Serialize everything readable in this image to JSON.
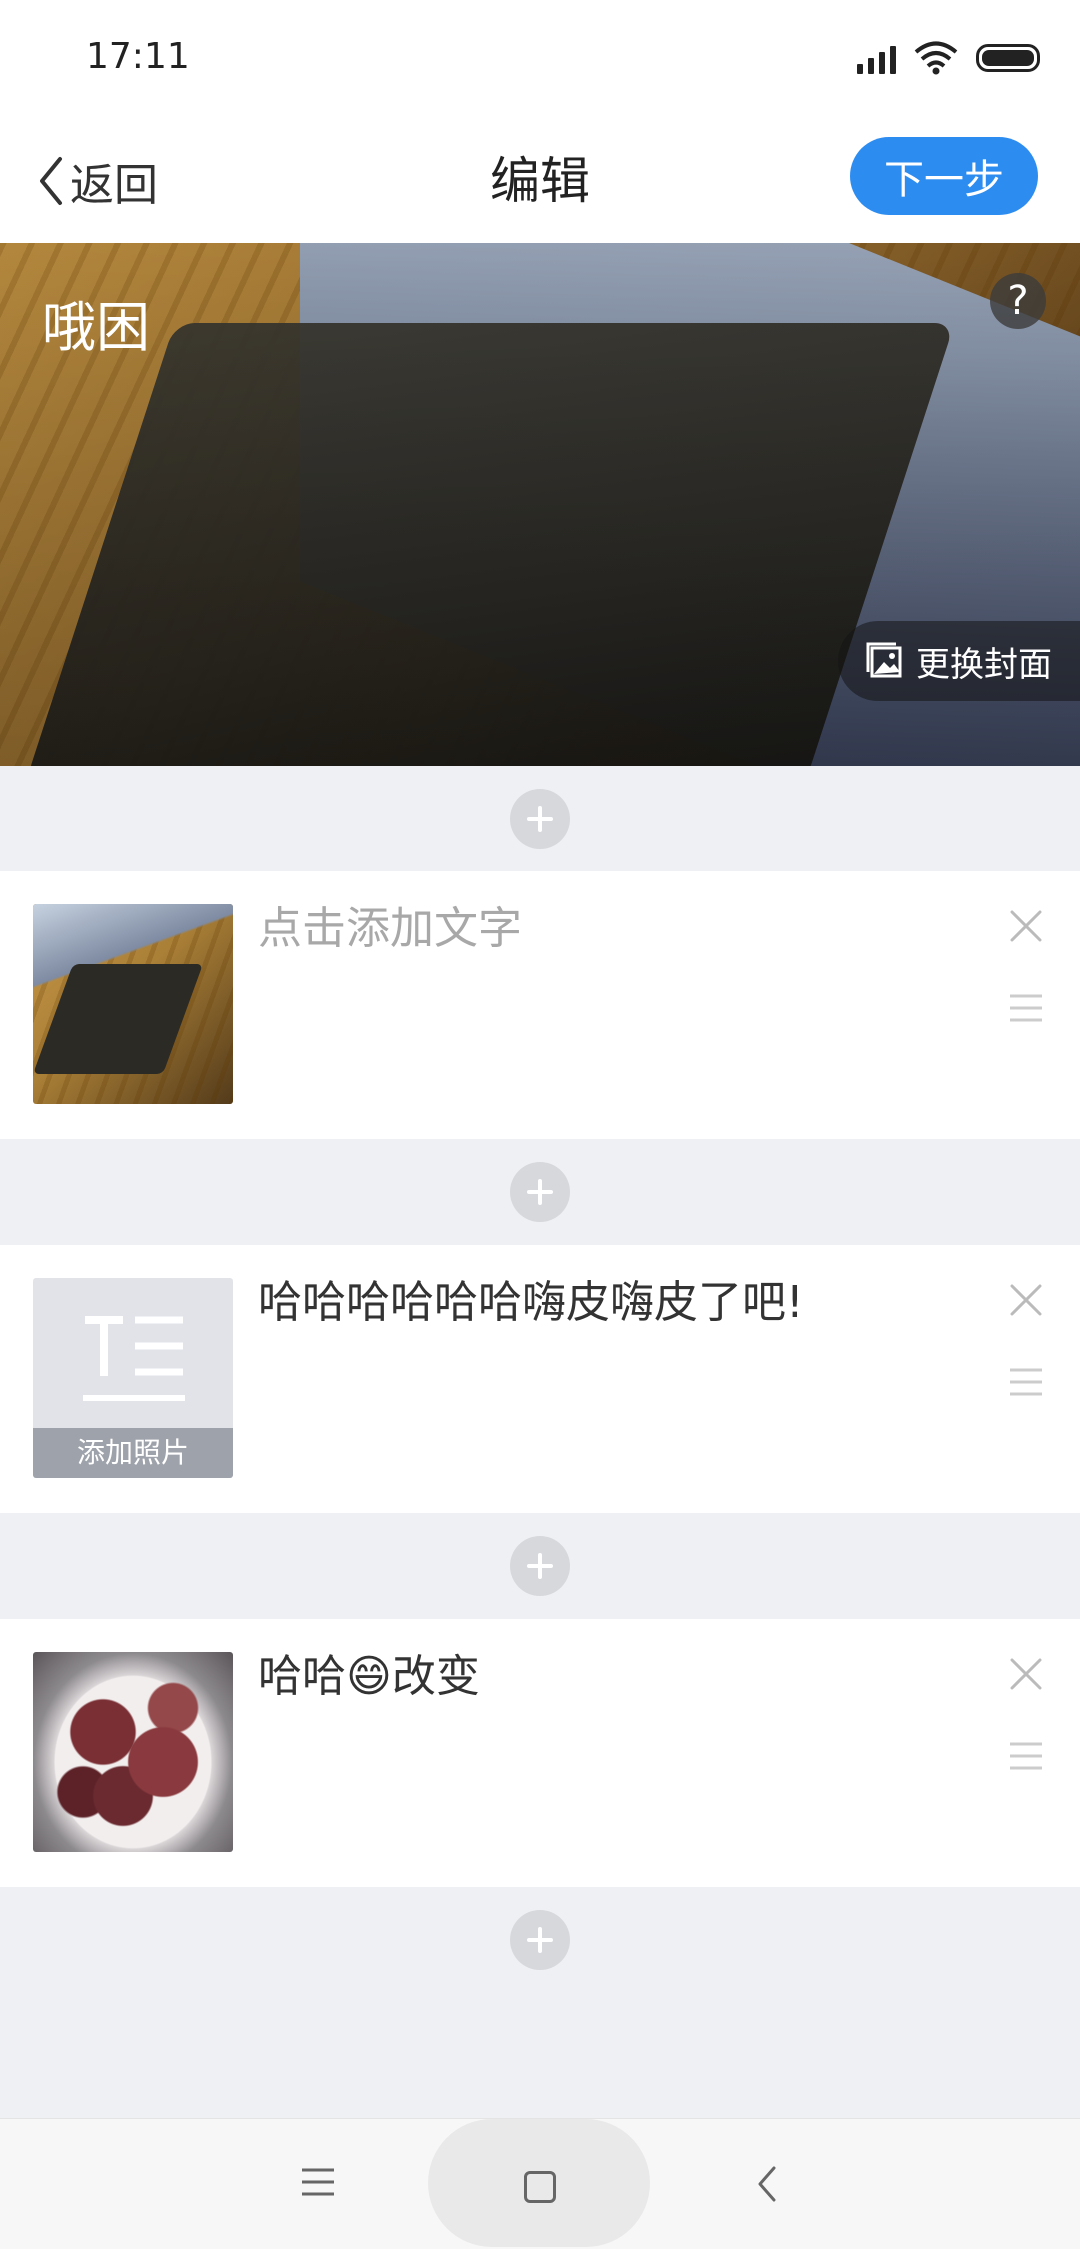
{
  "status_bar": {
    "time": "17:11"
  },
  "header": {
    "back_label": "返回",
    "title": "编辑",
    "next_label": "下一步"
  },
  "cover": {
    "title": "哦困",
    "help_label": "?",
    "change_cover_label": "更换封面"
  },
  "items": [
    {
      "text": "点击添加文字",
      "is_placeholder": true,
      "thumb": "monitor-photo"
    },
    {
      "text": "哈哈哈哈哈哈嗨皮嗨皮了吧!",
      "is_placeholder": false,
      "thumb": "text-icon",
      "thumb_label": "添加照片"
    },
    {
      "text": "哈哈😄改变",
      "is_placeholder": false,
      "thumb": "food-photo"
    }
  ],
  "colors": {
    "accent": "#2d8cf0",
    "background": "#eef0f3"
  },
  "icons": [
    "back-chevron-icon",
    "help-icon",
    "image-icon",
    "plus-icon",
    "close-icon",
    "drag-handle-icon",
    "text-edit-icon",
    "menu-icon",
    "home-icon",
    "back-icon"
  ]
}
